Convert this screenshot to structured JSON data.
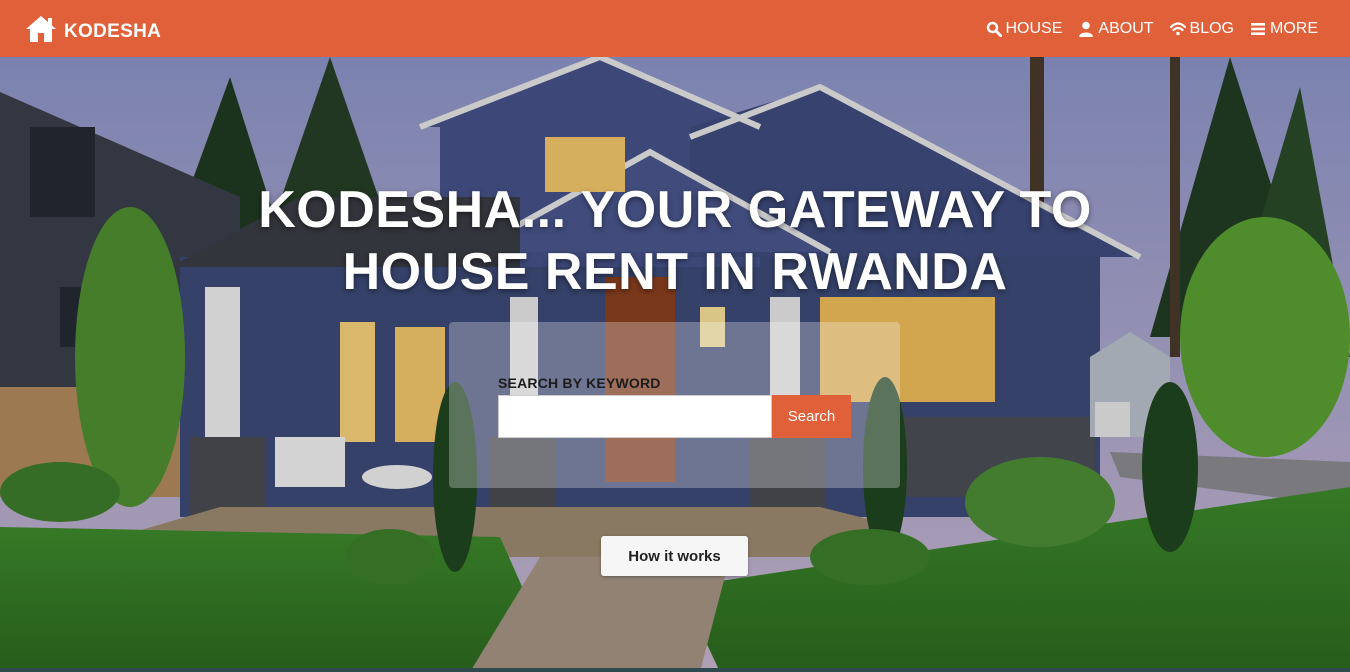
{
  "brand": {
    "name": "KODESHA",
    "icon": "home-icon"
  },
  "nav": {
    "items": [
      {
        "label": "HOUSE",
        "icon": "search-icon"
      },
      {
        "label": "ABOUT",
        "icon": "user-icon"
      },
      {
        "label": "BLOG",
        "icon": "wifi-icon"
      },
      {
        "label": "MORE",
        "icon": "menu-icon"
      }
    ]
  },
  "hero": {
    "title_line1": "KODESHA... YOUR GATEWAY TO",
    "title_line2": "HOUSE RENT IN RWANDA",
    "background": "house-photo"
  },
  "search": {
    "label": "SEARCH BY KEYWORD",
    "value": "",
    "placeholder": "",
    "button_label": "Search"
  },
  "cta": {
    "how_it_works_label": "How it works"
  },
  "colors": {
    "accent": "#e0603a",
    "navbar_text": "#ffffff"
  }
}
